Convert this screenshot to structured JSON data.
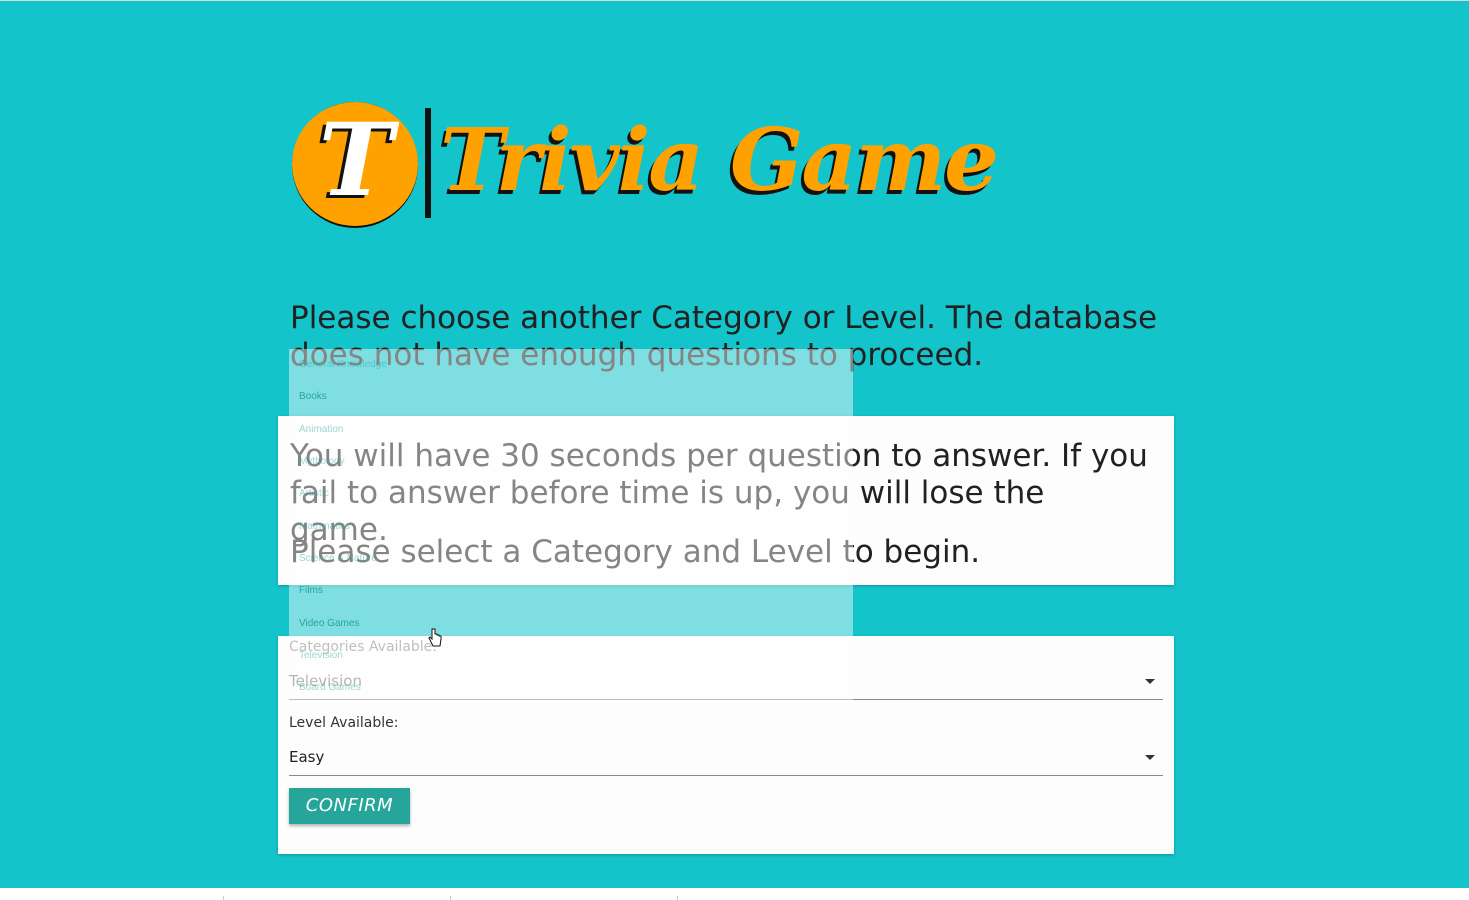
{
  "logo": {
    "letter": "T",
    "title": "Trivia Game"
  },
  "error_message": "Please choose another Category or Level. The database does not have enough questions to proceed.",
  "instructions": {
    "line1": "You will have 30 seconds per question to answer. If you fail to answer before time is up, you will lose the game.",
    "line2": "Please select a Category and Level to begin."
  },
  "form": {
    "category_label": "Categories Available:",
    "category_value": "Television",
    "level_label": "Level Available:",
    "level_value": "Easy",
    "confirm_label": "CONFIRM"
  },
  "dropdown": {
    "options": [
      "General Knowledge",
      "Books",
      "Animation",
      "Mythology",
      "Artistic",
      "Mathmatics",
      "Science & Nature",
      "Films",
      "Video Games",
      "Television",
      "Board Games"
    ]
  },
  "colors": {
    "background": "#14c4cb",
    "logo_orange": "#ffa200",
    "button": "#26a69a"
  }
}
